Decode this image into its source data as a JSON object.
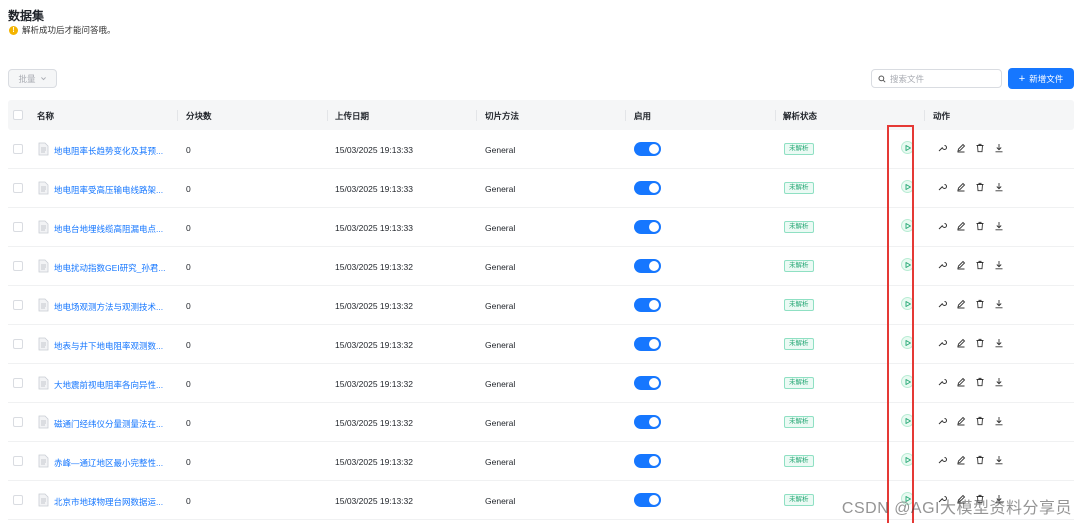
{
  "page": {
    "title": "数据集",
    "tip": "解析成功后才能问答哦。"
  },
  "toolbar": {
    "batch_label": "批量",
    "search_placeholder": "搜索文件",
    "new_file_label": "新增文件"
  },
  "columns": [
    "名称",
    "分块数",
    "上传日期",
    "切片方法",
    "启用",
    "解析状态",
    "动作"
  ],
  "rows": [
    {
      "name": "地电阻率长趋势变化及其预...",
      "chunks": "0",
      "date": "15/03/2025 19:13:33",
      "method": "General",
      "enabled": true,
      "status": "未解析"
    },
    {
      "name": "地电阻率受高压输电线路架...",
      "chunks": "0",
      "date": "15/03/2025 19:13:33",
      "method": "General",
      "enabled": true,
      "status": "未解析"
    },
    {
      "name": "地电台地埋线缆高阻漏电点...",
      "chunks": "0",
      "date": "15/03/2025 19:13:33",
      "method": "General",
      "enabled": true,
      "status": "未解析"
    },
    {
      "name": "地电扰动指数GEI研究_孙君...",
      "chunks": "0",
      "date": "15/03/2025 19:13:32",
      "method": "General",
      "enabled": true,
      "status": "未解析"
    },
    {
      "name": "地电场观测方法与观测技术...",
      "chunks": "0",
      "date": "15/03/2025 19:13:32",
      "method": "General",
      "enabled": true,
      "status": "未解析"
    },
    {
      "name": "地表与井下地电阻率观测数...",
      "chunks": "0",
      "date": "15/03/2025 19:13:32",
      "method": "General",
      "enabled": true,
      "status": "未解析"
    },
    {
      "name": "大地震前视电阻率各向异性...",
      "chunks": "0",
      "date": "15/03/2025 19:13:32",
      "method": "General",
      "enabled": true,
      "status": "未解析"
    },
    {
      "name": "磁通门经纬仪分量测量法在...",
      "chunks": "0",
      "date": "15/03/2025 19:13:32",
      "method": "General",
      "enabled": true,
      "status": "未解析"
    },
    {
      "name": "赤峰—通辽地区最小完整性...",
      "chunks": "0",
      "date": "15/03/2025 19:13:32",
      "method": "General",
      "enabled": true,
      "status": "未解析"
    },
    {
      "name": "北京市地球物理台网数据运...",
      "chunks": "0",
      "date": "15/03/2025 19:13:32",
      "method": "General",
      "enabled": true,
      "status": "未解析"
    }
  ],
  "icons": {
    "play": "play-icon",
    "actions": [
      "wrench-icon",
      "edit-icon",
      "trash-icon",
      "download-icon"
    ]
  },
  "colors": {
    "primary": "#1677ff",
    "status_green": "#25a774",
    "highlight_red": "#e53935"
  },
  "watermark": "CSDN @AGI大模型资料分享员"
}
